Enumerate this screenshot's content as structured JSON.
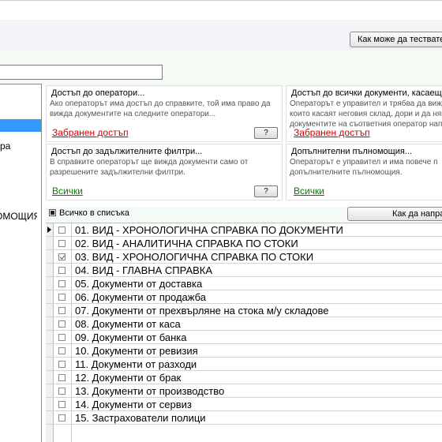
{
  "toolbar": {
    "how_test_label": "Как може да тествате"
  },
  "left_list": {
    "items": [
      {
        "label": ""
      },
      {
        "label": "ра"
      },
      {
        "label": "ОМОЩИЯ"
      }
    ]
  },
  "panels": {
    "operators": {
      "title": "Достъп до оператори...",
      "desc_1": "Ако операторът има достъп до справките, той има право да",
      "desc_2": "вижда документите на следните оператори...",
      "link": "Забранен достъп",
      "help_label": "?"
    },
    "all_docs": {
      "title": "Достъп до всички документи, касаещ",
      "desc_1": "Операторът е управител и трябва да вижд",
      "desc_2": "които касаят неговия склад, дори и да ням",
      "desc_3": "документите на съответния оператор нап",
      "link": "Забранен достъп"
    },
    "filters": {
      "title": "Достъп до задължителните филтри...",
      "desc_1": "В справките операторът ще вижда документи само от",
      "desc_2": "разрешените задължителни филтри.",
      "link": "Всички",
      "help_label": "?"
    },
    "extra_powers": {
      "title": "Допълнителни пълномощия...",
      "desc_1": "Операторът е управител и има повече п",
      "desc_2": "допълнителните пълномощия.",
      "link": "Всички"
    }
  },
  "list": {
    "select_all_label": "Всичко в списъка",
    "how_set_label": "Как да напра",
    "rows": [
      {
        "label": "01. ВИД - ХРОНОЛОГИЧНА СПРАВКА ПО ДОКУМЕНТИ",
        "checked": false,
        "current": true
      },
      {
        "label": "02. ВИД - АНАЛИТИЧНА СПРАВКА ПО СТОКИ",
        "checked": false,
        "current": false
      },
      {
        "label": "03. ВИД - ХРОНОЛОГИЧНА СПРАВКА ПО СТОКИ",
        "checked": true,
        "current": false
      },
      {
        "label": "04. ВИД - ГЛАВНА СПРАВКА",
        "checked": false,
        "current": false
      },
      {
        "label": "05. Документи от доставка",
        "checked": false,
        "current": false
      },
      {
        "label": "06. Документи от продажба",
        "checked": false,
        "current": false
      },
      {
        "label": "07. Документи от прехвърляне на стока м/у складове",
        "checked": false,
        "current": false
      },
      {
        "label": "08. Документи от каса",
        "checked": false,
        "current": false
      },
      {
        "label": "09. Документи от банка",
        "checked": false,
        "current": false
      },
      {
        "label": "10. Документи от ревизия",
        "checked": false,
        "current": false
      },
      {
        "label": "11. Документи от разходи",
        "checked": false,
        "current": false
      },
      {
        "label": "12. Документи от брак",
        "checked": false,
        "current": false
      },
      {
        "label": "13. Документи от производство",
        "checked": false,
        "current": false
      },
      {
        "label": "14. Документи от сервиз",
        "checked": false,
        "current": false
      },
      {
        "label": "15. Застрахователи полици",
        "checked": false,
        "current": false
      }
    ]
  }
}
